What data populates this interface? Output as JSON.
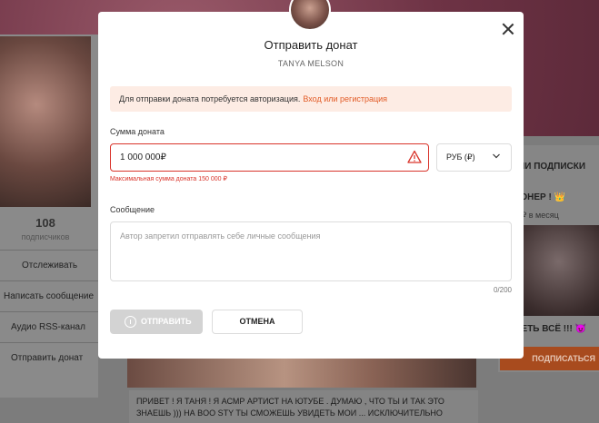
{
  "background": {
    "subscriber_count": "108",
    "subscriber_label": "подписчиков",
    "menu": [
      {
        "label": "Отслеживать"
      },
      {
        "label": "Написать сообщение"
      },
      {
        "label": "Аудио RSS-канал"
      },
      {
        "label": "Отправить донат"
      }
    ],
    "right_panel": {
      "title": "НИ ПОДПИСКИ",
      "tier_name": "ПИОНЕР ! 👑",
      "tier_price": "? ₽ в месяц",
      "tier_line": "ВИДЕТЬ ВСЁ !!! 😈",
      "subscribe_label": "ПОДПИСАТЬСЯ"
    },
    "post_text": "ПРИВЕТ ! Я ТАНЯ ! Я АСМР АРТИСТ НА ЮТУБЕ . ДУМАЮ , ЧТО ТЫ И ТАК ЭТО ЗНАЕШЬ ))) НА BOO STY ТЫ СМОЖЕШЬ УВИДЕТЬ МОИ ... ИСКЛЮЧИТЕЛЬНО"
  },
  "modal": {
    "title": "Отправить донат",
    "subtitle": "TANYA MELSON",
    "notice_text": "Для отправки доната потребуется авторизация.",
    "notice_link": "Вход или регистрация",
    "amount_label": "Сумма доната",
    "amount_value": "1 000 000₽",
    "amount_error": "Максимальная сумма доната 150 000 ₽",
    "currency_value": "РУБ (₽)",
    "message_label": "Сообщение",
    "message_placeholder": "Автор запретил отправлять себе личные сообщения",
    "message_counter": "0/200",
    "send_label": "ОТПРАВИТЬ",
    "cancel_label": "ОТМЕНА",
    "colors": {
      "accent": "#e25b26",
      "error": "#d9342b",
      "notice_bg": "#fdece4",
      "disabled_button": "#d3d3d3"
    },
    "icons": [
      "close-icon",
      "warning-icon",
      "chevron-down-icon",
      "info-icon"
    ]
  }
}
